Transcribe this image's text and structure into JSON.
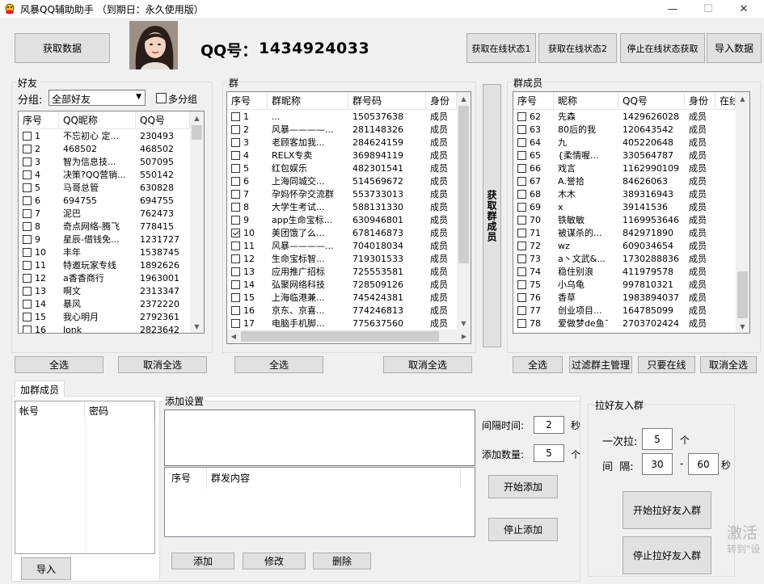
{
  "window": {
    "title": "风暴QQ辅助助手  （到期日：永久使用版）",
    "minimize": "—",
    "maximize": "☐",
    "close": "✕"
  },
  "top": {
    "fetch_data": "获取数据",
    "qq_label": "QQ号：",
    "qq_number": "1434924033",
    "online1": "获取在线状态1",
    "online2": "获取在线状态2",
    "stop_online": "停止在线状态获取",
    "import_data": "导入数据"
  },
  "friends": {
    "label": "好友",
    "group_label": "分组:",
    "group_value": "全部好友",
    "multi_group": "多分组",
    "columns": [
      "序号",
      "QQ昵称",
      "QQ号"
    ],
    "rows": [
      [
        "1",
        "不忘初心 定...",
        "230493"
      ],
      [
        "2",
        "468502",
        "468502"
      ],
      [
        "3",
        "智为信息技...",
        "507095"
      ],
      [
        "4",
        "决策?QQ营销...",
        "550142"
      ],
      [
        "5",
        "马哥总管",
        "630828"
      ],
      [
        "6",
        "694755",
        "694755"
      ],
      [
        "7",
        "泥巴",
        "762473"
      ],
      [
        "8",
        "奇点网络-腾飞",
        "778415"
      ],
      [
        "9",
        "星辰-借钱免...",
        "1231727"
      ],
      [
        "10",
        "丰年",
        "1538745"
      ],
      [
        "11",
        "特邀玩家专线",
        "1892626"
      ],
      [
        "12",
        "  a香香商行",
        "1963001"
      ],
      [
        "13",
        "啊文",
        "2313347"
      ],
      [
        "14",
        "暴风",
        "2372220"
      ],
      [
        "15",
        "我心明月",
        "2792361"
      ],
      [
        "16",
        "lonk",
        "2823642"
      ]
    ],
    "select_all": "全选",
    "deselect_all": "取消全选"
  },
  "groups": {
    "label": "群",
    "columns": [
      "序号",
      "群昵称",
      "群号码",
      "身份"
    ],
    "rows": [
      [
        "1",
        "...",
        "150537638",
        "成员"
      ],
      [
        "2",
        "风暴————...",
        "281148326",
        "成员"
      ],
      [
        "3",
        "老顾客加我...",
        "284624159",
        "成员"
      ],
      [
        "4",
        "RELX专卖",
        "369894119",
        "成员"
      ],
      [
        "5",
        "红包娱乐",
        "482301541",
        "成员"
      ],
      [
        "6",
        "上海同城交...",
        "514569672",
        "成员"
      ],
      [
        "7",
        "孕妈怀孕交流群",
        "553733013",
        "成员"
      ],
      [
        "8",
        "大学生考试...",
        "588131330",
        "成员"
      ],
      [
        "9",
        "app生命宝标...",
        "630946801",
        "成员"
      ],
      [
        "10",
        "美团饿了么...",
        "678146873",
        "成员"
      ],
      [
        "11",
        "风暴————...",
        "704018034",
        "成员"
      ],
      [
        "12",
        "生命宝标智...",
        "719301533",
        "成员"
      ],
      [
        "13",
        "应用推广招标",
        "725553581",
        "成员"
      ],
      [
        "14",
        "弘聚网络科技",
        "728509126",
        "成员"
      ],
      [
        "15",
        "上海临港兼...",
        "745424381",
        "成员"
      ],
      [
        "16",
        "京东、京喜...",
        "774246813",
        "成员"
      ],
      [
        "17",
        "电脑手机脚...",
        "775637560",
        "成员"
      ]
    ],
    "checked_index": 9,
    "select_all": "全选",
    "deselect_all": "取消全选",
    "fetch_members": "获取群成员"
  },
  "members": {
    "label": "群成员",
    "columns": [
      "序号",
      "昵称",
      "QQ号",
      "身份",
      "在线"
    ],
    "rows": [
      [
        "62",
        "先森",
        "1429626028",
        "成员"
      ],
      [
        "63",
        "80后的我",
        "120643542",
        "成员"
      ],
      [
        "64",
        "九",
        "405220648",
        "成员"
      ],
      [
        "65",
        "{柔情喔...",
        "330564787",
        "成员"
      ],
      [
        "66",
        "戏言",
        "1162990109",
        "成员"
      ],
      [
        "67",
        "A.誉拾",
        "84626063",
        "成员"
      ],
      [
        "68",
        "木木",
        "389316943",
        "成员"
      ],
      [
        "69",
        "x",
        "39141536",
        "成员"
      ],
      [
        "70",
        "铁敏敏",
        "1169953646",
        "成员"
      ],
      [
        "71",
        "被谋杀的...",
        "842971890",
        "成员"
      ],
      [
        "72",
        "wz",
        "609034654",
        "成员"
      ],
      [
        "73",
        "a丶文武&...",
        "1730288836",
        "成员"
      ],
      [
        "74",
        "稳住别浪",
        "411979578",
        "成员"
      ],
      [
        "75",
        "小乌龟",
        "997810321",
        "成员"
      ],
      [
        "76",
        "香草",
        "1983894037",
        "成员"
      ],
      [
        "77",
        "创业项目...",
        "164785099",
        "成员"
      ],
      [
        "78",
        "爱做梦de鱼¯",
        "2703702424",
        "成员"
      ]
    ],
    "select_all": "全选",
    "filter_owner": "过滤群主管理",
    "only_online": "只要在线",
    "deselect_all": "取消全选"
  },
  "add_members": {
    "tab": "加群成员",
    "columns": [
      "帐号",
      "密码"
    ],
    "import": "导入"
  },
  "add_settings": {
    "label": "添加设置",
    "interval_label": "间隔时间:",
    "interval_value": "2",
    "interval_unit": "秒",
    "count_label": "添加数量:",
    "count_value": "5",
    "count_unit": "个",
    "columns": [
      "序号",
      "群发内容"
    ],
    "start": "开始添加",
    "stop": "停止添加",
    "add": "添加",
    "edit": "修改",
    "delete": "删除"
  },
  "pull_friends": {
    "label": "拉好友入群",
    "once_label": "一次拉:",
    "once_value": "5",
    "once_unit": "个",
    "interval_label": "间  隔:",
    "interval_min": "30",
    "dash": "-",
    "interval_max": "60",
    "interval_unit": "秒",
    "start": "开始拉好友入群",
    "stop": "停止拉好友入群"
  },
  "watermark": {
    "line1": "激活",
    "line2": "转到\"设"
  }
}
